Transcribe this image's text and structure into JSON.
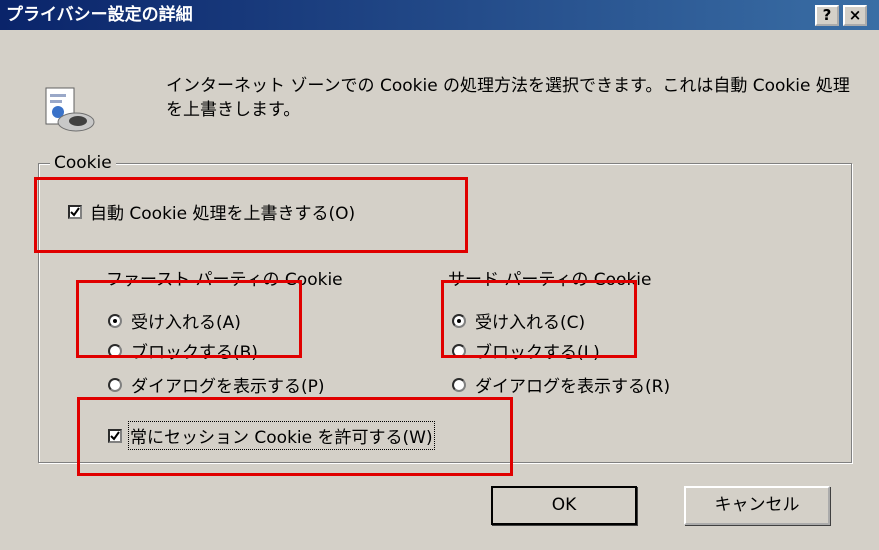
{
  "window": {
    "title": "プライバシー設定の詳細",
    "help_button": "?",
    "close_button": "×"
  },
  "description": "インターネット ゾーンでの Cookie の処理方法を選択できます。これは自動 Cookie 処理を上書きします。",
  "group": {
    "label": "Cookie",
    "override_checkbox": {
      "label": "自動 Cookie 処理を上書きする(O)",
      "checked": true
    },
    "first_party": {
      "header": "ファースト パーティの Cookie",
      "options": [
        {
          "label": "受け入れる(A)",
          "selected": true
        },
        {
          "label": "ブロックする(B)",
          "selected": false
        },
        {
          "label": "ダイアログを表示する(P)",
          "selected": false
        }
      ]
    },
    "third_party": {
      "header": "サード パーティの Cookie",
      "options": [
        {
          "label": "受け入れる(C)",
          "selected": true
        },
        {
          "label": "ブロックする(L)",
          "selected": false
        },
        {
          "label": "ダイアログを表示する(R)",
          "selected": false
        }
      ]
    },
    "session_checkbox": {
      "label": "常にセッション Cookie を許可する(W)",
      "checked": true
    }
  },
  "buttons": {
    "ok": "OK",
    "cancel": "キャンセル"
  },
  "colors": {
    "highlight": "#e00000",
    "titlebar": "#0a246a",
    "face": "#d4d0c8"
  }
}
